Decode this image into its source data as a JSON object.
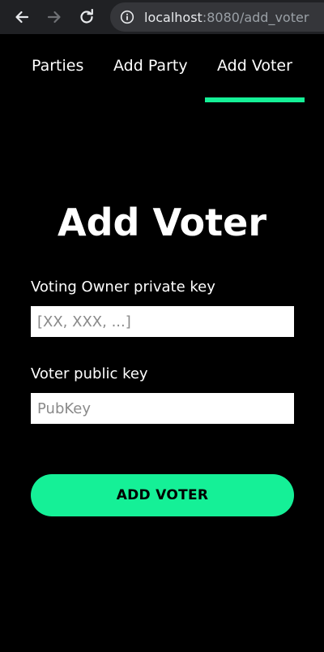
{
  "browser": {
    "url_host": "localhost",
    "url_path": ":8080/add_voter"
  },
  "tabs": [
    {
      "label": "Parties",
      "active": false
    },
    {
      "label": "Add Party",
      "active": false
    },
    {
      "label": "Add Voter",
      "active": true
    }
  ],
  "colors": {
    "accent": "#15f097",
    "background": "#000000"
  },
  "form": {
    "title": "Add Voter",
    "owner_key": {
      "label": "Voting Owner private key",
      "placeholder": "[XX, XXX, ...]",
      "value": ""
    },
    "voter_key": {
      "label": "Voter public key",
      "placeholder": "PubKey",
      "value": ""
    },
    "submit_label": "ADD VOTER"
  },
  "icons": {
    "back": "arrow-left-icon",
    "forward": "arrow-right-icon",
    "reload": "reload-icon",
    "site_info": "info-icon"
  }
}
